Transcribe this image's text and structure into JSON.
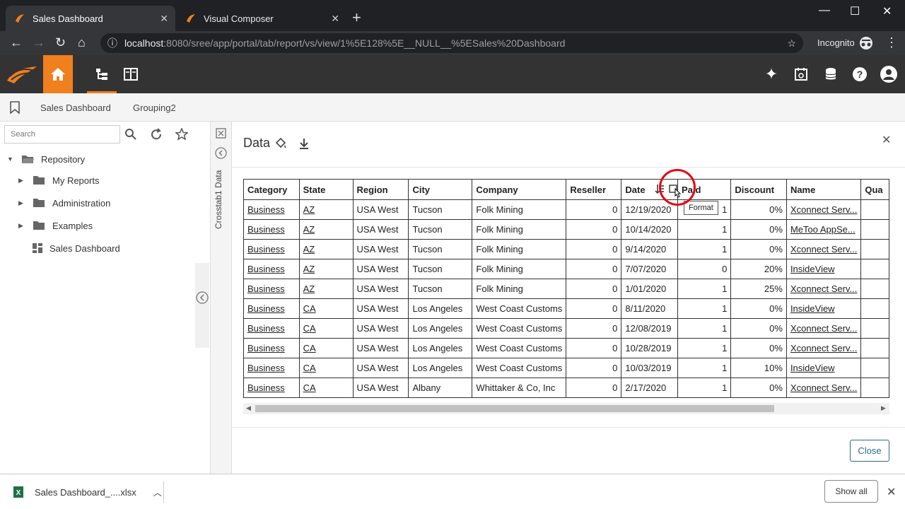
{
  "browser": {
    "tabs": [
      {
        "title": "Sales Dashboard",
        "close": "✕"
      },
      {
        "title": "Visual Composer",
        "close": "✕"
      }
    ],
    "newtab": "+",
    "url_host": "localhost",
    "url_path": ":8080/sree/app/portal/tab/report/vs/view/1%5E128%5E__NULL__%5ESales%20Dashboard",
    "profile": "Incognito",
    "window_controls": {
      "minimize": "—",
      "maximize": "☐",
      "close": "✕"
    }
  },
  "colors": {
    "accent": "#f07f1d",
    "annotation": "#e30613",
    "header_bg": "#333333"
  },
  "breadcrumb": [
    "Sales Dashboard",
    "Grouping2"
  ],
  "sidebar": {
    "search_placeholder": "Search",
    "tree": [
      {
        "label": "Repository",
        "expanded": true,
        "icon": "folder-open-icon"
      },
      {
        "label": "My Reports",
        "icon": "folder-icon"
      },
      {
        "label": "Administration",
        "icon": "folder-icon"
      },
      {
        "label": "Examples",
        "icon": "folder-icon"
      },
      {
        "label": "Sales Dashboard",
        "icon": "dashboard-icon"
      }
    ]
  },
  "rail_label": "Crosstab1 Data",
  "panel": {
    "title": "Data",
    "close_button": "Close",
    "tooltip": "Format"
  },
  "table": {
    "columns": [
      "Category",
      "State",
      "Region",
      "City",
      "Company",
      "Reseller",
      "Date",
      "Paid",
      "Discount",
      "Name",
      "Qua"
    ],
    "rows": [
      [
        "Business",
        "AZ",
        "USA West",
        "Tucson",
        "Folk Mining",
        "0",
        "12/19/2020",
        "1",
        "0%",
        "Xconnect Serv..."
      ],
      [
        "Business",
        "AZ",
        "USA West",
        "Tucson",
        "Folk Mining",
        "0",
        "10/14/2020",
        "1",
        "0%",
        "MeToo AppSe..."
      ],
      [
        "Business",
        "AZ",
        "USA West",
        "Tucson",
        "Folk Mining",
        "0",
        "9/14/2020",
        "1",
        "0%",
        "Xconnect Serv..."
      ],
      [
        "Business",
        "AZ",
        "USA West",
        "Tucson",
        "Folk Mining",
        "0",
        "7/07/2020",
        "0",
        "20%",
        "InsideView"
      ],
      [
        "Business",
        "AZ",
        "USA West",
        "Tucson",
        "Folk Mining",
        "0",
        "1/01/2020",
        "1",
        "25%",
        "Xconnect Serv..."
      ],
      [
        "Business",
        "CA",
        "USA West",
        "Los Angeles",
        "West Coast Customs",
        "0",
        "8/11/2020",
        "1",
        "0%",
        "InsideView"
      ],
      [
        "Business",
        "CA",
        "USA West",
        "Los Angeles",
        "West Coast Customs",
        "0",
        "12/08/2019",
        "1",
        "0%",
        "Xconnect Serv..."
      ],
      [
        "Business",
        "CA",
        "USA West",
        "Los Angeles",
        "West Coast Customs",
        "0",
        "10/28/2019",
        "1",
        "0%",
        "Xconnect Serv..."
      ],
      [
        "Business",
        "CA",
        "USA West",
        "Los Angeles",
        "West Coast Customs",
        "0",
        "10/03/2019",
        "1",
        "10%",
        "InsideView"
      ],
      [
        "Business",
        "CA",
        "USA West",
        "Albany",
        "Whittaker & Co, Inc",
        "0",
        "2/17/2020",
        "1",
        "0%",
        "Xconnect Serv..."
      ]
    ]
  },
  "download": {
    "filename": "Sales Dashboard_....xlsx",
    "show_all": "Show all"
  }
}
